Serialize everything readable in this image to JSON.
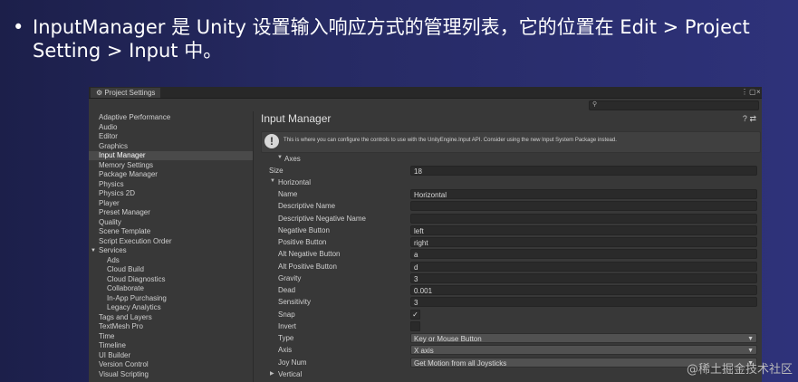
{
  "slide": {
    "bullet": "•",
    "text": "InputManager 是 Unity 设置输入响应方式的管理列表，它的位置在 Edit > Project Setting > Input 中。"
  },
  "window": {
    "title": "Project Settings",
    "search_icon": "⚲",
    "search_placeholder": ""
  },
  "sidebar": {
    "items": [
      {
        "label": "Adaptive Performance",
        "sub": false,
        "sel": false
      },
      {
        "label": "Audio",
        "sub": false,
        "sel": false
      },
      {
        "label": "Editor",
        "sub": false,
        "sel": false
      },
      {
        "label": "Graphics",
        "sub": false,
        "sel": false
      },
      {
        "label": "Input Manager",
        "sub": false,
        "sel": true
      },
      {
        "label": "Memory Settings",
        "sub": false,
        "sel": false
      },
      {
        "label": "Package Manager",
        "sub": false,
        "sel": false
      },
      {
        "label": "Physics",
        "sub": false,
        "sel": false
      },
      {
        "label": "Physics 2D",
        "sub": false,
        "sel": false
      },
      {
        "label": "Player",
        "sub": false,
        "sel": false
      },
      {
        "label": "Preset Manager",
        "sub": false,
        "sel": false
      },
      {
        "label": "Quality",
        "sub": false,
        "sel": false
      },
      {
        "label": "Scene Template",
        "sub": false,
        "sel": false
      },
      {
        "label": "Script Execution Order",
        "sub": false,
        "sel": false
      },
      {
        "label": "Services",
        "sub": false,
        "sel": false
      },
      {
        "label": "Ads",
        "sub": true,
        "sel": false
      },
      {
        "label": "Cloud Build",
        "sub": true,
        "sel": false
      },
      {
        "label": "Cloud Diagnostics",
        "sub": true,
        "sel": false
      },
      {
        "label": "Collaborate",
        "sub": true,
        "sel": false
      },
      {
        "label": "In-App Purchasing",
        "sub": true,
        "sel": false
      },
      {
        "label": "Legacy Analytics",
        "sub": true,
        "sel": false
      },
      {
        "label": "Tags and Layers",
        "sub": false,
        "sel": false
      },
      {
        "label": "TextMesh Pro",
        "sub": false,
        "sel": false
      },
      {
        "label": "Time",
        "sub": false,
        "sel": false
      },
      {
        "label": "Timeline",
        "sub": false,
        "sel": false
      },
      {
        "label": "UI Builder",
        "sub": false,
        "sel": false
      },
      {
        "label": "Version Control",
        "sub": false,
        "sel": false
      },
      {
        "label": "Visual Scripting",
        "sub": false,
        "sel": false
      }
    ],
    "services_toggle": "▼"
  },
  "main": {
    "title": "Input Manager",
    "help_icon": "?",
    "settings_icon": "⇄",
    "info_icon": "!",
    "info_text": "This is where you can configure the controls to use with the UnityEngine.Input API. Consider using the new Input System Package instead.",
    "axes_label": "Axes",
    "size_label": "Size",
    "size_value": "18",
    "horizontal_label": "Horizontal",
    "vertical_label": "Vertical",
    "props": [
      {
        "label": "Name",
        "value": "Horizontal",
        "kind": "text"
      },
      {
        "label": "Descriptive Name",
        "value": "",
        "kind": "text"
      },
      {
        "label": "Descriptive Negative Name",
        "value": "",
        "kind": "text"
      },
      {
        "label": "Negative Button",
        "value": "left",
        "kind": "text"
      },
      {
        "label": "Positive Button",
        "value": "right",
        "kind": "text"
      },
      {
        "label": "Alt Negative Button",
        "value": "a",
        "kind": "text"
      },
      {
        "label": "Alt Positive Button",
        "value": "d",
        "kind": "text"
      },
      {
        "label": "Gravity",
        "value": "3",
        "kind": "text"
      },
      {
        "label": "Dead",
        "value": "0.001",
        "kind": "text"
      },
      {
        "label": "Sensitivity",
        "value": "3",
        "kind": "text"
      },
      {
        "label": "Snap",
        "value": "✓",
        "kind": "check"
      },
      {
        "label": "Invert",
        "value": "",
        "kind": "check"
      },
      {
        "label": "Type",
        "value": "Key or Mouse Button",
        "kind": "dropdown"
      },
      {
        "label": "Axis",
        "value": "X axis",
        "kind": "dropdown"
      },
      {
        "label": "Joy Num",
        "value": "Get Motion from all Joysticks",
        "kind": "dropdown"
      }
    ]
  },
  "watermark": "@稀土掘金技术社区"
}
